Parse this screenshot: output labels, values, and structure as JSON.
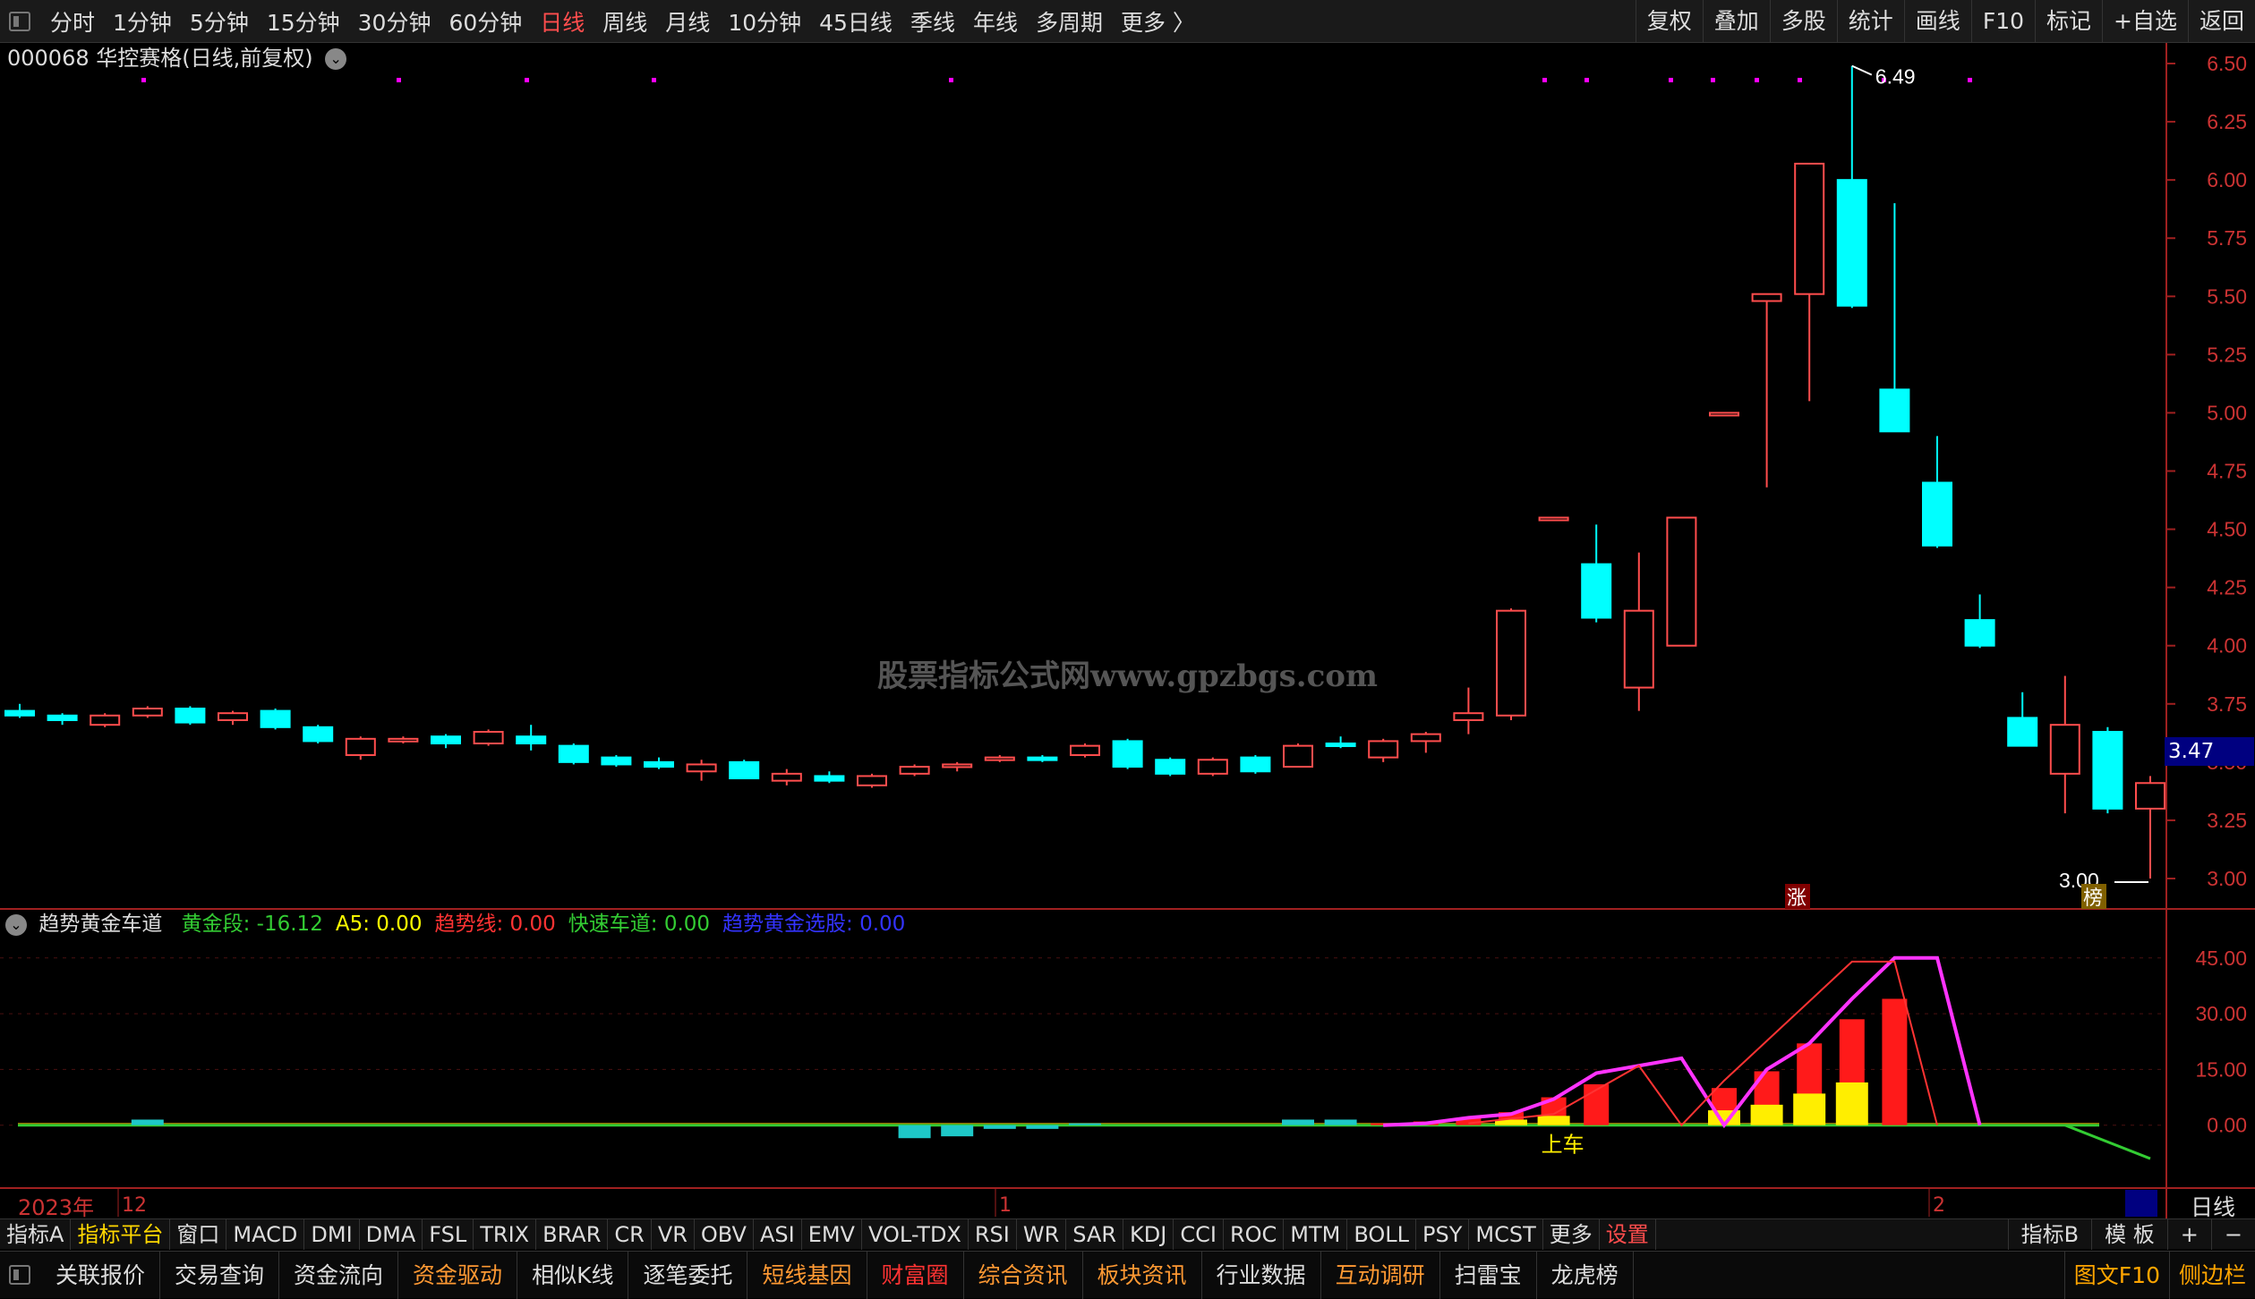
{
  "topbar": {
    "periods": [
      "分时",
      "1分钟",
      "5分钟",
      "15分钟",
      "30分钟",
      "60分钟",
      "日线",
      "周线",
      "月线",
      "10分钟",
      "45日线",
      "季线",
      "年线",
      "多周期",
      "更多 〉"
    ],
    "active_period": "日线",
    "right_buttons": [
      "复权",
      "叠加",
      "多股",
      "统计",
      "画线",
      "F10",
      "标记",
      "+自选",
      "返回"
    ]
  },
  "stock": {
    "title": "000068 华控赛格(日线,前复权)"
  },
  "price_axis": {
    "labels": [
      "6.50",
      "6.25",
      "6.00",
      "5.75",
      "5.50",
      "5.25",
      "5.00",
      "4.75",
      "4.50",
      "4.25",
      "4.00",
      "3.75",
      "3.50",
      "3.25",
      "3.00"
    ],
    "current_price": "3.47"
  },
  "annotations": {
    "high": "6.49",
    "low": "3.00",
    "marker_zhang": "涨",
    "marker_bang": "榜",
    "signal": "上车"
  },
  "watermark": "股票指标公式网www.gpzbgs.com",
  "indicator": {
    "name": "趋势黄金车道",
    "fields": [
      {
        "label": "黄金段: -16.12",
        "color": "#33cc33"
      },
      {
        "label": "A5: 0.00",
        "color": "#ffff00"
      },
      {
        "label": "趋势线: 0.00",
        "color": "#ff3333"
      },
      {
        "label": "快速车道: 0.00",
        "color": "#33cc33"
      },
      {
        "label": "趋势黄金选股: 0.00",
        "color": "#3333ff"
      }
    ],
    "axis_labels": [
      "45.00",
      "30.00",
      "15.00",
      "0.00"
    ]
  },
  "xaxis": {
    "year_label": "2023年",
    "month_labels": [
      "12",
      "1",
      "2"
    ],
    "unit": "日线"
  },
  "tabbar": {
    "items": [
      "指标A",
      "指标平台",
      "窗口",
      "MACD",
      "DMI",
      "DMA",
      "FSL",
      "TRIX",
      "BRAR",
      "CR",
      "VR",
      "OBV",
      "ASI",
      "EMV",
      "VOL-TDX",
      "RSI",
      "WR",
      "SAR",
      "KDJ",
      "CCI",
      "ROC",
      "MTM",
      "BOLL",
      "PSY",
      "MCST",
      "更多",
      "设置"
    ],
    "right": [
      "指标B",
      "模 板",
      "+",
      "−"
    ]
  },
  "bottombar": {
    "items": [
      "关联报价",
      "交易查询",
      "资金流向",
      "资金驱动",
      "相似K线",
      "逐笔委托",
      "短线基因",
      "财富圈",
      "综合资讯",
      "板块资讯",
      "行业数据",
      "互动调研",
      "扫雷宝",
      "龙虎榜"
    ],
    "right": [
      "图文F10",
      "侧边栏"
    ]
  },
  "chart_data": {
    "type": "candlestick",
    "ylim": [
      2.95,
      6.55
    ],
    "candles": [
      {
        "o": 3.72,
        "h": 3.75,
        "l": 3.69,
        "c": 3.7
      },
      {
        "o": 3.7,
        "h": 3.71,
        "l": 3.66,
        "c": 3.68
      },
      {
        "o": 3.66,
        "h": 3.71,
        "l": 3.65,
        "c": 3.7
      },
      {
        "o": 3.7,
        "h": 3.74,
        "l": 3.69,
        "c": 3.73
      },
      {
        "o": 3.73,
        "h": 3.74,
        "l": 3.66,
        "c": 3.67
      },
      {
        "o": 3.68,
        "h": 3.72,
        "l": 3.66,
        "c": 3.71
      },
      {
        "o": 3.72,
        "h": 3.73,
        "l": 3.64,
        "c": 3.65
      },
      {
        "o": 3.65,
        "h": 3.66,
        "l": 3.58,
        "c": 3.59
      },
      {
        "o": 3.53,
        "h": 3.61,
        "l": 3.51,
        "c": 3.6
      },
      {
        "o": 3.59,
        "h": 3.61,
        "l": 3.58,
        "c": 3.6
      },
      {
        "o": 3.61,
        "h": 3.62,
        "l": 3.56,
        "c": 3.58
      },
      {
        "o": 3.58,
        "h": 3.64,
        "l": 3.57,
        "c": 3.63
      },
      {
        "o": 3.61,
        "h": 3.66,
        "l": 3.55,
        "c": 3.58
      },
      {
        "o": 3.57,
        "h": 3.58,
        "l": 3.49,
        "c": 3.5
      },
      {
        "o": 3.52,
        "h": 3.53,
        "l": 3.48,
        "c": 3.49
      },
      {
        "o": 3.5,
        "h": 3.52,
        "l": 3.47,
        "c": 3.48
      },
      {
        "o": 3.46,
        "h": 3.51,
        "l": 3.42,
        "c": 3.49
      },
      {
        "o": 3.5,
        "h": 3.51,
        "l": 3.43,
        "c": 3.43
      },
      {
        "o": 3.42,
        "h": 3.47,
        "l": 3.4,
        "c": 3.45
      },
      {
        "o": 3.44,
        "h": 3.46,
        "l": 3.41,
        "c": 3.42
      },
      {
        "o": 3.4,
        "h": 3.45,
        "l": 3.39,
        "c": 3.44
      },
      {
        "o": 3.45,
        "h": 3.49,
        "l": 3.44,
        "c": 3.48
      },
      {
        "o": 3.48,
        "h": 3.5,
        "l": 3.46,
        "c": 3.49
      },
      {
        "o": 3.51,
        "h": 3.53,
        "l": 3.5,
        "c": 3.52
      },
      {
        "o": 3.52,
        "h": 3.53,
        "l": 3.5,
        "c": 3.51
      },
      {
        "o": 3.53,
        "h": 3.58,
        "l": 3.52,
        "c": 3.57
      },
      {
        "o": 3.59,
        "h": 3.6,
        "l": 3.47,
        "c": 3.48
      },
      {
        "o": 3.51,
        "h": 3.52,
        "l": 3.44,
        "c": 3.45
      },
      {
        "o": 3.45,
        "h": 3.52,
        "l": 3.44,
        "c": 3.51
      },
      {
        "o": 3.52,
        "h": 3.53,
        "l": 3.45,
        "c": 3.46
      },
      {
        "o": 3.48,
        "h": 3.58,
        "l": 3.48,
        "c": 3.57
      },
      {
        "o": 3.58,
        "h": 3.61,
        "l": 3.56,
        "c": 3.57
      },
      {
        "o": 3.52,
        "h": 3.6,
        "l": 3.5,
        "c": 3.59
      },
      {
        "o": 3.59,
        "h": 3.63,
        "l": 3.54,
        "c": 3.62
      },
      {
        "o": 3.68,
        "h": 3.82,
        "l": 3.62,
        "c": 3.71
      },
      {
        "o": 3.7,
        "h": 4.16,
        "l": 3.68,
        "c": 4.15
      },
      {
        "o": 4.55,
        "h": 4.55,
        "l": 4.55,
        "c": 4.55
      },
      {
        "o": 4.35,
        "h": 4.52,
        "l": 4.1,
        "c": 4.12
      },
      {
        "o": 3.82,
        "h": 4.4,
        "l": 3.72,
        "c": 4.15
      },
      {
        "o": 4.0,
        "h": 4.55,
        "l": 4.0,
        "c": 4.55
      },
      {
        "o": 5.0,
        "h": 5.0,
        "l": 5.0,
        "c": 5.0
      },
      {
        "o": 5.48,
        "h": 5.51,
        "l": 4.68,
        "c": 5.51
      },
      {
        "o": 5.51,
        "h": 6.07,
        "l": 5.05,
        "c": 6.07
      },
      {
        "o": 6.0,
        "h": 6.49,
        "l": 5.45,
        "c": 5.46
      },
      {
        "o": 5.1,
        "h": 5.9,
        "l": 4.92,
        "c": 4.92
      },
      {
        "o": 4.7,
        "h": 4.9,
        "l": 4.42,
        "c": 4.43
      },
      {
        "o": 4.11,
        "h": 4.22,
        "l": 3.99,
        "c": 4.0
      },
      {
        "o": 3.69,
        "h": 3.8,
        "l": 3.57,
        "c": 3.57
      },
      {
        "o": 3.45,
        "h": 3.87,
        "l": 3.28,
        "c": 3.66
      },
      {
        "o": 3.63,
        "h": 3.65,
        "l": 3.28,
        "c": 3.3
      },
      {
        "o": 3.3,
        "h": 3.44,
        "l": 3.0,
        "c": 3.41
      }
    ],
    "indicator_ylim": [
      -15,
      50
    ],
    "magenta_line": [
      0,
      0,
      0,
      0,
      0,
      0,
      0,
      0,
      0,
      0,
      0,
      0,
      0,
      0,
      0,
      0,
      0,
      0,
      0,
      0,
      0,
      0,
      0,
      0,
      0,
      0,
      0,
      0,
      0,
      0,
      0,
      0,
      0,
      0.5,
      2,
      3,
      7,
      14,
      16,
      18,
      0,
      15,
      22,
      34,
      45,
      45,
      0,
      0,
      0,
      0,
      0,
      0
    ],
    "red_bars": [
      0,
      0,
      0,
      0,
      0,
      0,
      0,
      0,
      0,
      0,
      0,
      0,
      0,
      0,
      0,
      0,
      0,
      0,
      0,
      0,
      0,
      0,
      0,
      0,
      0,
      0,
      0,
      0,
      0,
      0,
      0,
      0,
      0.5,
      1,
      2,
      3.5,
      7.5,
      11,
      0,
      0,
      10,
      14.5,
      22,
      28.5,
      34,
      0,
      0,
      0,
      0,
      0,
      0,
      0
    ],
    "yellow_bars": [
      0,
      0,
      0,
      0,
      0,
      0,
      0,
      0,
      0,
      0,
      0,
      0,
      0,
      0,
      0,
      0,
      0,
      0,
      0,
      0,
      0,
      0,
      0,
      0,
      0,
      0,
      0,
      0,
      0,
      0,
      0,
      0,
      0,
      0,
      0,
      1.5,
      2.5,
      0,
      0,
      0,
      4,
      5.5,
      8.5,
      11.5,
      0,
      0,
      0,
      0,
      0,
      0,
      0,
      0
    ],
    "cyan_bars": [
      0,
      0,
      0,
      1.5,
      0,
      0,
      0,
      0,
      0,
      0,
      0,
      0,
      0,
      0,
      0,
      0,
      0,
      0,
      0,
      0,
      0,
      -3.5,
      -3,
      -1,
      -1,
      0.5,
      0,
      0,
      0,
      0,
      1.5,
      1.5,
      0,
      0,
      0,
      0,
      0,
      0,
      0,
      0,
      0,
      0,
      0,
      0,
      0,
      0,
      0,
      0,
      0,
      0,
      0
    ]
  }
}
